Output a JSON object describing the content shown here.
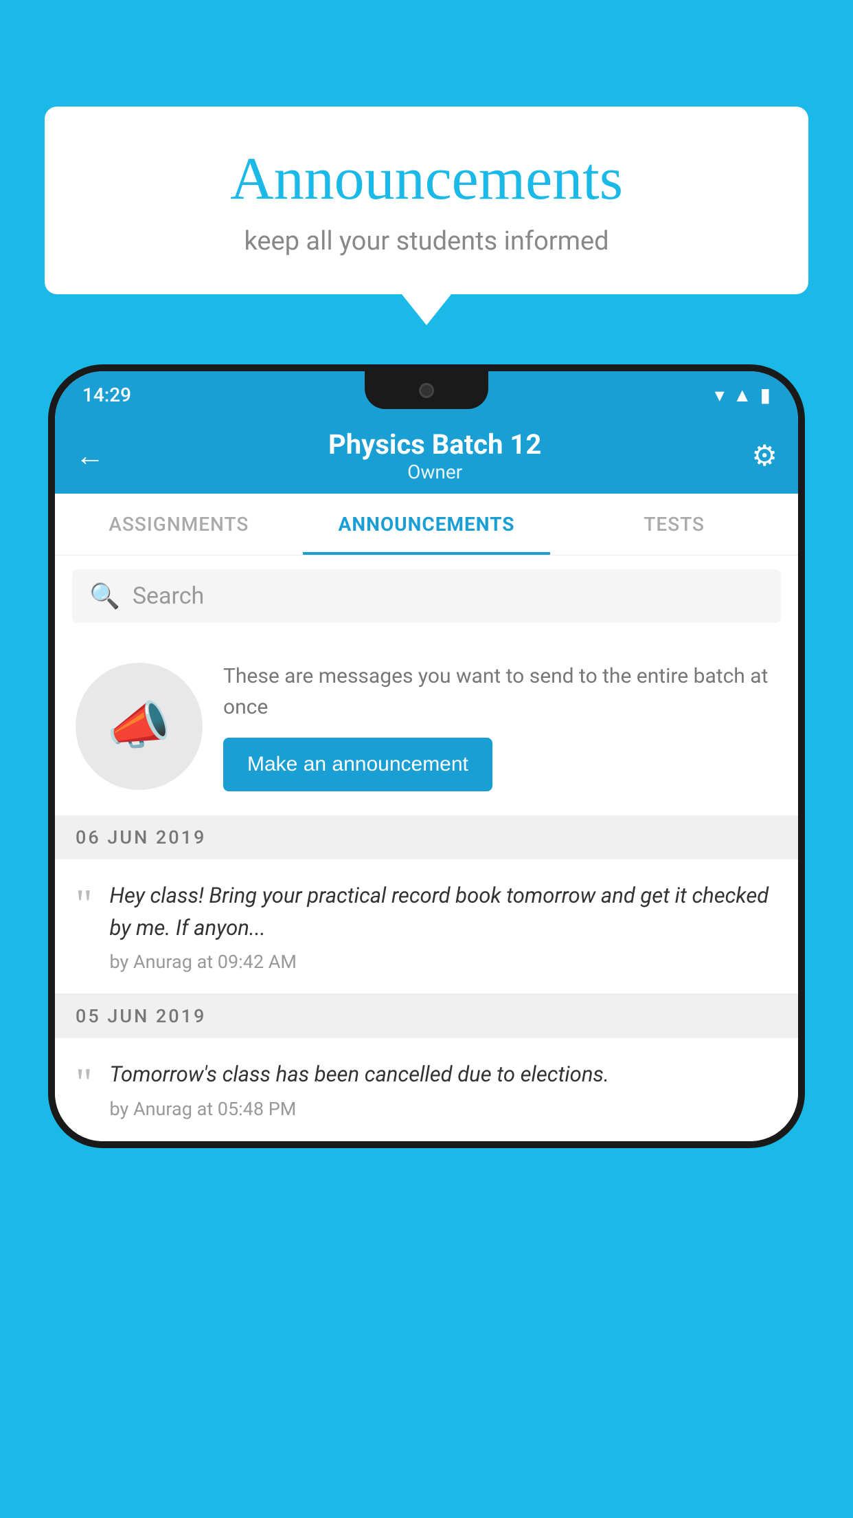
{
  "background_color": "#1ab9e8",
  "speech_bubble": {
    "title": "Announcements",
    "subtitle": "keep all your students informed"
  },
  "phone": {
    "status_bar": {
      "time": "14:29",
      "icons": [
        "wifi",
        "signal",
        "battery"
      ]
    },
    "app_bar": {
      "title": "Physics Batch 12",
      "subtitle": "Owner",
      "back_label": "←",
      "settings_label": "⚙"
    },
    "tabs": [
      {
        "label": "ASSIGNMENTS",
        "active": false
      },
      {
        "label": "ANNOUNCEMENTS",
        "active": true
      },
      {
        "label": "TESTS",
        "active": false
      }
    ],
    "search": {
      "placeholder": "Search"
    },
    "promo": {
      "description": "These are messages you want to send to the entire batch at once",
      "button_label": "Make an announcement"
    },
    "announcements": [
      {
        "date": "06  JUN  2019",
        "message": "Hey class! Bring your practical record book tomorrow and get it checked by me. If anyon...",
        "meta": "by Anurag at 09:42 AM"
      },
      {
        "date": "05  JUN  2019",
        "message": "Tomorrow's class has been cancelled due to elections.",
        "meta": "by Anurag at 05:48 PM"
      }
    ]
  }
}
